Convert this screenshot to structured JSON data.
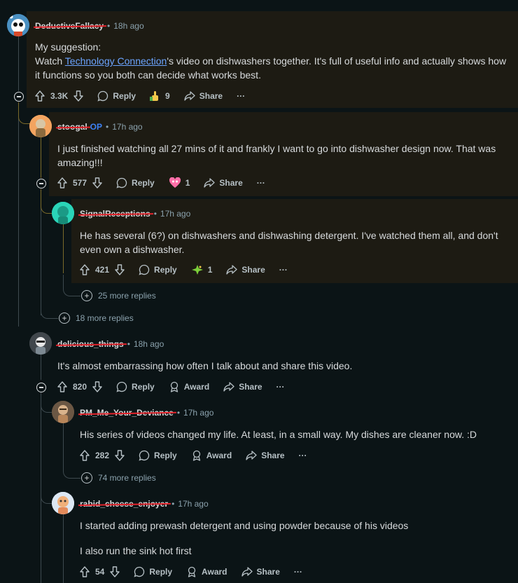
{
  "comments": [
    {
      "user": "DeductiveFallacy",
      "time": "18h ago",
      "body_intro": "My suggestion:",
      "body_pre": "Watch ",
      "body_link": "Technology Connection",
      "body_post": "'s video on dishwashers together. It's full of useful info and actually shows how it functions so you both can decide what works best.",
      "score": "3.3K",
      "award_count": "9",
      "reply_label": "Reply",
      "share_label": "Share",
      "more_label": "···"
    },
    {
      "user": "stoogal",
      "op_label": "OP",
      "time": "17h ago",
      "body": "I just finished watching all 27 mins of it and frankly I want to go into dishwasher design now. That was amazing!!!",
      "score": "577",
      "award_count": "1",
      "reply_label": "Reply",
      "share_label": "Share",
      "more_label": "···"
    },
    {
      "user": "SignalReceptions",
      "time": "17h ago",
      "body": "He has several (6?) on dishwashers and dishwashing detergent. I've watched them all, and don't even own a dishwasher.",
      "score": "421",
      "award_count": "1",
      "reply_label": "Reply",
      "share_label": "Share",
      "more_label": "···",
      "more_replies": "25 more replies"
    },
    {
      "more_replies": "18 more replies"
    },
    {
      "user": "delicious_things",
      "time": "18h ago",
      "body": "It's almost embarrassing how often I talk about and share this video.",
      "score": "820",
      "reply_label": "Reply",
      "award_label": "Award",
      "share_label": "Share",
      "more_label": "···"
    },
    {
      "user": "PM_Me_Your_Deviance",
      "time": "17h ago",
      "body": "His series of videos changed my life. At least, in a small way. My dishes are cleaner now. :D",
      "score": "282",
      "reply_label": "Reply",
      "award_label": "Award",
      "share_label": "Share",
      "more_label": "···",
      "more_replies": "74 more replies"
    },
    {
      "user": "rabid_cheese_enjoyer",
      "time": "17h ago",
      "body_1": "I started adding prewash detergent and using powder because of his videos",
      "body_2": "I also run the sink hot first",
      "score": "54",
      "reply_label": "Reply",
      "award_label": "Award",
      "share_label": "Share",
      "more_label": "···"
    }
  ],
  "colors": {
    "background": "#0b1416",
    "highlight": "#1d1b13",
    "link": "#6ba4ff",
    "op": "#3c82f6",
    "redaction": "#e3232b"
  }
}
